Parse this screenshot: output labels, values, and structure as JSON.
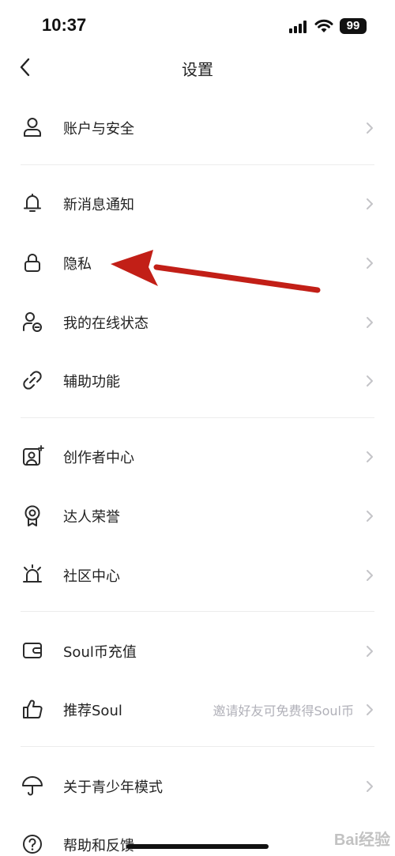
{
  "status_bar": {
    "time": "10:37",
    "battery": "99"
  },
  "nav": {
    "title": "设置"
  },
  "rows": [
    {
      "label": "账户与安全",
      "hint": ""
    },
    {
      "label": "新消息通知",
      "hint": ""
    },
    {
      "label": "隐私",
      "hint": ""
    },
    {
      "label": "我的在线状态",
      "hint": ""
    },
    {
      "label": "辅助功能",
      "hint": ""
    },
    {
      "label": "创作者中心",
      "hint": ""
    },
    {
      "label": "达人荣誉",
      "hint": ""
    },
    {
      "label": "社区中心",
      "hint": ""
    },
    {
      "label": "Soul币充值",
      "hint": ""
    },
    {
      "label": "推荐Soul",
      "hint": "邀请好友可免费得Soul币"
    },
    {
      "label": "关于青少年模式",
      "hint": ""
    },
    {
      "label": "帮助和反馈",
      "hint": ""
    }
  ],
  "colors": {
    "annotation_arrow": "#c21f17",
    "icon_stroke": "#2a2a2a",
    "chevron": "#c4c4c8"
  },
  "watermark": "Bai经验"
}
